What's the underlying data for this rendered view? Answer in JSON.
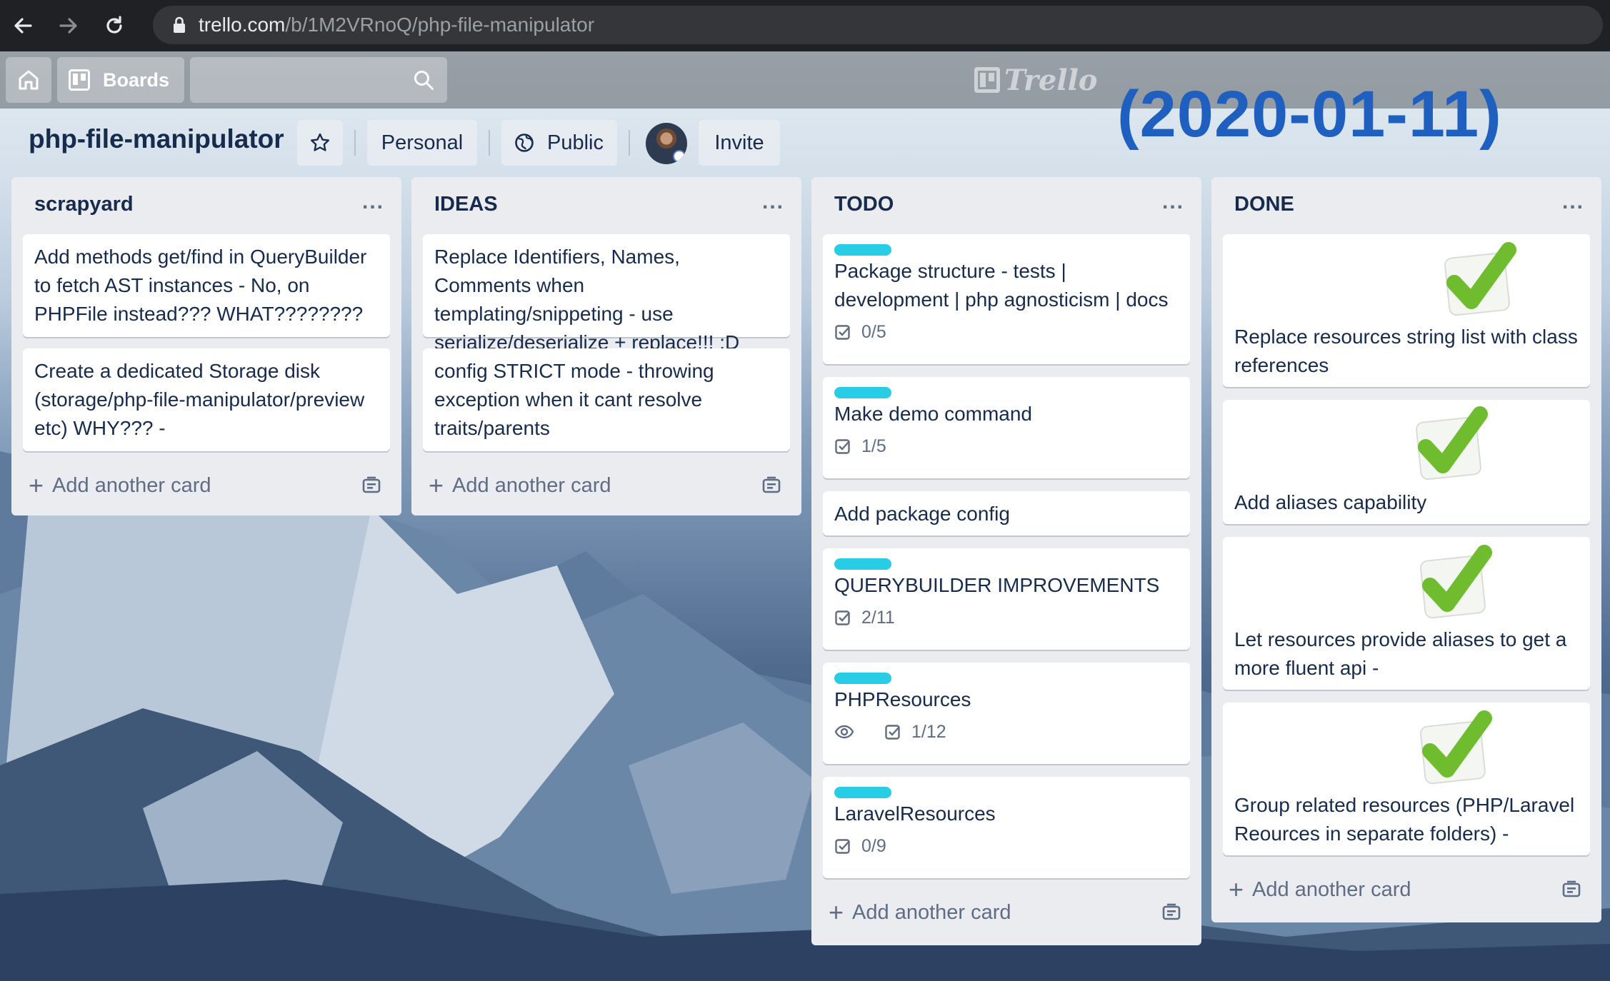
{
  "browser": {
    "url_host": "trello.com",
    "url_path": "/b/1M2VRnoQ/php-file-manipulator",
    "icons": [
      "back-arrow-icon",
      "forward-arrow-icon",
      "reload-icon",
      "lock-icon"
    ]
  },
  "header": {
    "boards_label": "Boards",
    "logo_text": "Trello",
    "search_placeholder": ""
  },
  "stamp": "(2020-01-11)",
  "board": {
    "title": "php-file-manipulator",
    "personal_label": "Personal",
    "visibility_label": "Public",
    "invite_label": "Invite"
  },
  "colors": {
    "label_cyan": "#29cce5",
    "list_bg": "#ebecf0",
    "stamp_blue": "#1f5fbf",
    "check_green": "#6fbd2e"
  },
  "lists": [
    {
      "title": "scrapyard",
      "menu": "...",
      "add_label": "Add another card",
      "cards": [
        {
          "text": "Add methods get/find in QueryBuilder to fetch AST instances - No, on PHPFile instead??? WHAT????????"
        },
        {
          "text": "Create a dedicated Storage disk (storage/php-file-manipulator/preview etc) WHY??? -"
        }
      ]
    },
    {
      "title": "IDEAS",
      "menu": "...",
      "add_label": "Add another card",
      "cards": [
        {
          "text": "Replace Identifiers, Names, Comments when templating/snippeting - use serialize/deserialize + replace!!! :D"
        },
        {
          "text": "config STRICT mode - throwing exception when it cant resolve traits/parents"
        }
      ]
    },
    {
      "title": "TODO",
      "menu": "...",
      "add_label": "Add another card",
      "cards": [
        {
          "text": "Package structure - tests | development | php agnosticism | docs",
          "checklist": "0/5"
        },
        {
          "text": "Make demo command",
          "checklist": "1/5"
        },
        {
          "text": "Add package config"
        },
        {
          "text": "QUERYBUILDER IMPROVEMENTS",
          "checklist": "2/11"
        },
        {
          "text": "PHPResources",
          "checklist": "1/12"
        },
        {
          "text": "LaravelResources",
          "checklist": "0/9"
        }
      ]
    },
    {
      "title": "DONE",
      "menu": "...",
      "add_label": "Add another card",
      "cards": [
        {
          "text": "Replace resources string list with class references"
        },
        {
          "text": "Add aliases capability"
        },
        {
          "text": "Let resources provide aliases to get a more fluent api -"
        },
        {
          "text": "Group related resources (PHP/Laravel Reources in separate folders) -"
        }
      ]
    }
  ]
}
